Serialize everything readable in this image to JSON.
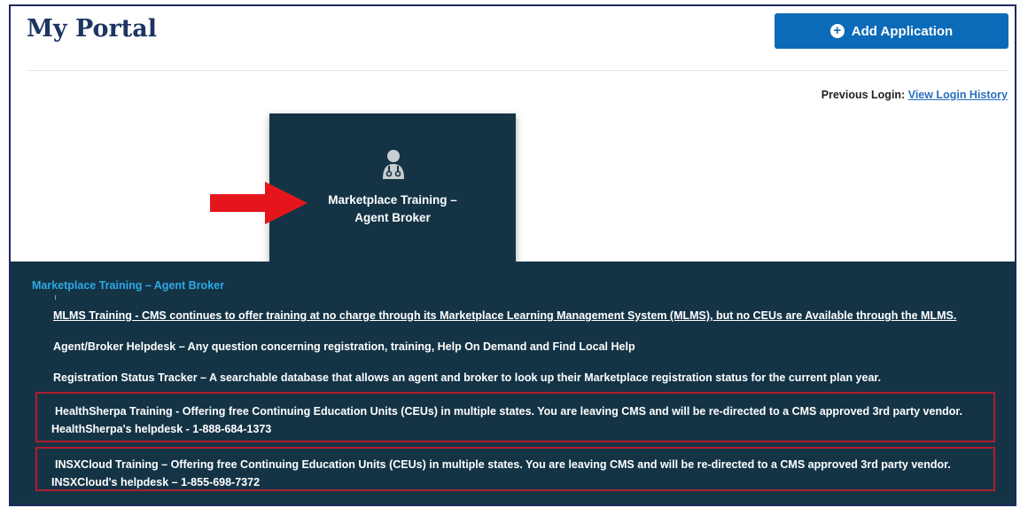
{
  "header": {
    "title": "My Portal",
    "add_button_label": "Add Application",
    "previous_login_label": "Previous Login:",
    "view_history_link": "View Login History"
  },
  "tile": {
    "icon": "doctor-person-icon",
    "title": "Marketplace Training –\nAgent Broker"
  },
  "panel": {
    "title": "Marketplace Training – Agent Broker",
    "links": [
      "MLMS Training - CMS continues to offer training at no charge through its Marketplace Learning Management System (MLMS), but no CEUs are Available through the MLMS.",
      "Agent/Broker Helpdesk – Any question concerning registration, training, Help On Demand and Find Local Help",
      "Registration Status Tracker – A searchable database that allows an agent and broker to look up their Marketplace registration status for the current plan year."
    ],
    "vendors": [
      {
        "link": "HealthSherpa Training - Offering free Continuing Education Units (CEUs) in multiple states. You are leaving CMS and will be re-directed to a CMS approved 3rd party vendor.",
        "helpdesk": "HealthSherpa's helpdesk - 1-888-684-1373"
      },
      {
        "link": "INSXCloud Training – Offering free Continuing Education Units (CEUs) in multiple states. You are leaving CMS and will be re-directed to a CMS approved 3rd party vendor.",
        "helpdesk": "INSXCloud's helpdesk – 1-855-698-7372"
      }
    ]
  },
  "colors": {
    "brand_navy": "#1d3563",
    "button_blue": "#0b6bb8",
    "panel_bg": "#143446",
    "panel_title": "#2ea8e6",
    "annotation_red": "#e5161b",
    "highlight_border": "#b01c2e"
  }
}
